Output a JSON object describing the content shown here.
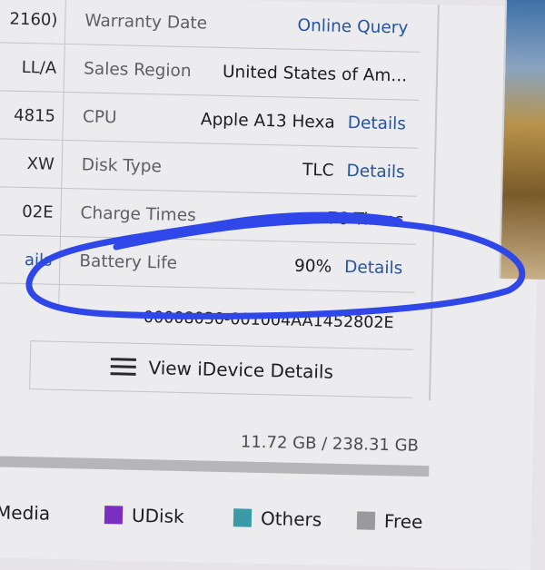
{
  "left_column": {
    "cells": [
      {
        "text": "2160)"
      },
      {
        "text": "LL/A"
      },
      {
        "text": "4815"
      },
      {
        "text": "XW"
      },
      {
        "text": "02E"
      },
      {
        "text": "ails",
        "link": true
      }
    ]
  },
  "device_info": {
    "rows": [
      {
        "label": "Warranty Date",
        "value": "",
        "detail": "Online Query"
      },
      {
        "label": "Sales Region",
        "value": "United States of Am...",
        "detail": ""
      },
      {
        "label": "CPU",
        "value": "Apple A13 Hexa",
        "detail": "Details"
      },
      {
        "label": "Disk Type",
        "value": "TLC",
        "detail": "Details"
      },
      {
        "label": "Charge Times",
        "value": "76 Times",
        "detail": ""
      },
      {
        "label": "Battery Life",
        "value": "90%",
        "detail": "Details"
      }
    ],
    "serial": "00008030-001004AA1452802E"
  },
  "view_button": {
    "label": "View iDevice Details",
    "icon": "list-icon"
  },
  "storage": {
    "text": "11.72 GB / 238.31 GB",
    "used_fraction": 0.049
  },
  "legend": [
    {
      "label": "Media",
      "color": ""
    },
    {
      "label": "UDisk",
      "color": "#7a2fc0"
    },
    {
      "label": "Others",
      "color": "#3a9aa8"
    },
    {
      "label": "Free",
      "color": "#9a9a9e"
    }
  ],
  "annotation": {
    "color": "#2f47e8",
    "target": "Battery Life"
  }
}
